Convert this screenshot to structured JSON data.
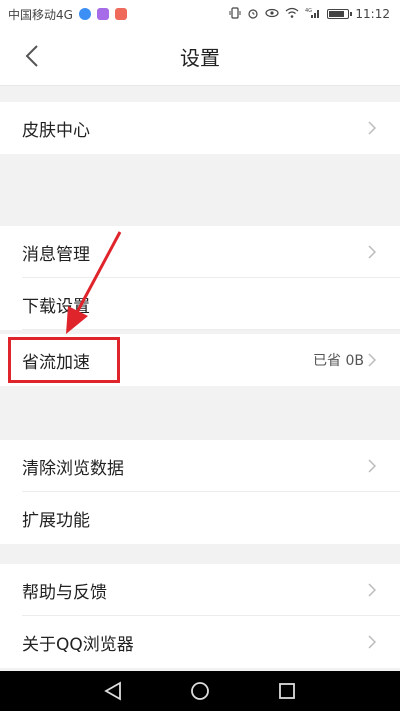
{
  "status_bar": {
    "carrier": "中国移动4G",
    "time": "11:12",
    "network": "4G"
  },
  "header": {
    "title": "设置"
  },
  "settings": {
    "skin_center": "皮肤中心",
    "message_management": "消息管理",
    "download_settings": "下载设置",
    "data_saving": "省流加速",
    "data_saving_value": "已省 0B",
    "clear_browsing_data": "清除浏览数据",
    "extensions": "扩展功能",
    "help_feedback": "帮助与反馈",
    "about_qq_browser": "关于QQ浏览器"
  },
  "colors": {
    "highlight": "#e0242b",
    "background": "#f2f2f2"
  }
}
